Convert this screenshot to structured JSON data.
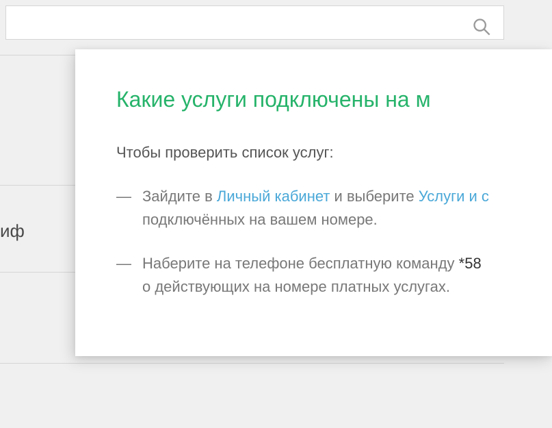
{
  "background": {
    "sidebar_label_fragment": "иф"
  },
  "card": {
    "title": "Какие услуги подключены на м",
    "intro": "Чтобы проверить список услуг:",
    "items": [
      {
        "prefix": "Зайдите в ",
        "link1": "Личный кабинет",
        "mid": " и выберите ",
        "link2": "Услуги и с",
        "line2": "подключённых на вашем номере."
      },
      {
        "prefix": "Наберите на телефоне бесплатную команду ",
        "cmd": "*58",
        "line2": "о действующих на номере платных услугах."
      }
    ]
  }
}
